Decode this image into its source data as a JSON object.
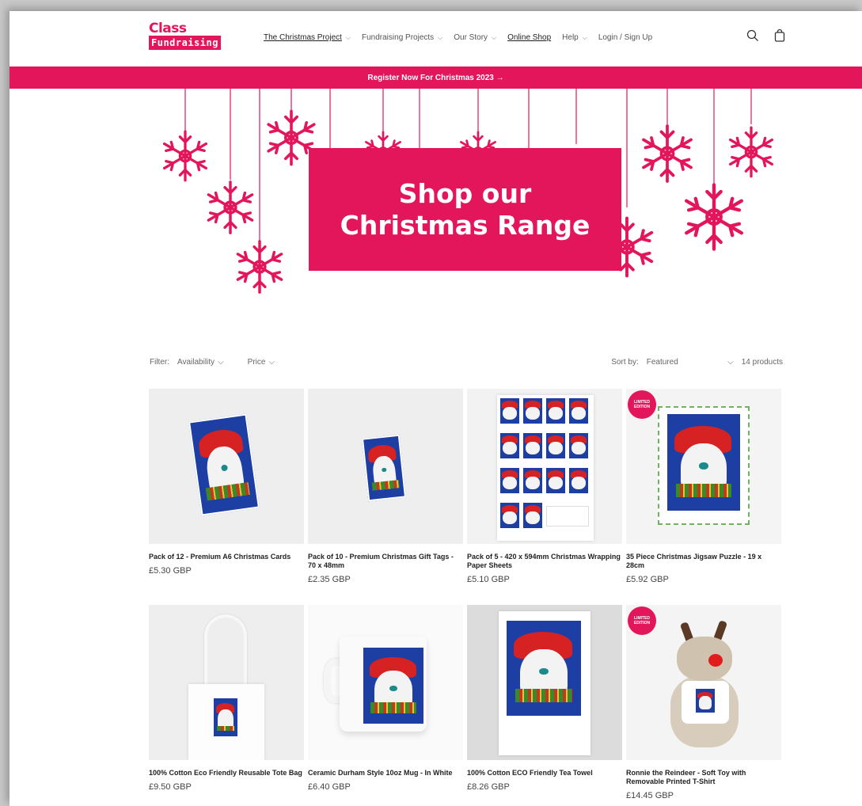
{
  "header": {
    "logo_top": "Class",
    "logo_bottom": "Fundraising",
    "nav": [
      {
        "label": "The Christmas Project",
        "dropdown": true
      },
      {
        "label": "Fundraising Projects",
        "dropdown": true
      },
      {
        "label": "Our Story",
        "dropdown": true
      },
      {
        "label": "Online Shop",
        "dropdown": false
      },
      {
        "label": "Help",
        "dropdown": true
      },
      {
        "label": "Login / Sign Up",
        "dropdown": false
      }
    ],
    "icons": [
      "search-icon",
      "cart-icon"
    ]
  },
  "announcement": {
    "text": "Register Now For Christmas 2023 →"
  },
  "hero": {
    "line1": "Shop our",
    "line2": "Christmas Range"
  },
  "filters": {
    "filter_label": "Filter:",
    "availability": "Availability",
    "price": "Price",
    "sort_label": "Sort by:",
    "sort_value": "Featured",
    "count": "14 products"
  },
  "products": [
    {
      "title": "Pack of 12 - Premium A6 Christmas Cards",
      "price": "£5.30 GBP",
      "badge": ""
    },
    {
      "title": "Pack of 10 - Premium Christmas Gift Tags - 70 x 48mm",
      "price": "£2.35 GBP",
      "badge": ""
    },
    {
      "title": "Pack of 5 - 420 x 594mm Christmas Wrapping Paper Sheets",
      "price": "£5.10 GBP",
      "badge": ""
    },
    {
      "title": "35 Piece Christmas Jigsaw Puzzle - 19 x 28cm",
      "price": "£5.92 GBP",
      "badge": "LIMITED EDITION"
    },
    {
      "title": "100% Cotton Eco Friendly Reusable Tote Bag",
      "price": "£9.50 GBP",
      "badge": ""
    },
    {
      "title": "Ceramic Durham Style 10oz Mug - In White",
      "price": "£6.40 GBP",
      "badge": ""
    },
    {
      "title": "100% Cotton ECO Friendly Tea Towel",
      "price": "£8.26 GBP",
      "badge": ""
    },
    {
      "title": "Ronnie the Reindeer - Soft Toy with Removable Printed T-Shirt",
      "price": "£14.45 GBP",
      "badge": "LIMITED EDITION"
    }
  ],
  "colors": {
    "brand": "#e3165b",
    "art_blue": "#1d3fa3",
    "hat_red": "#d62222"
  }
}
